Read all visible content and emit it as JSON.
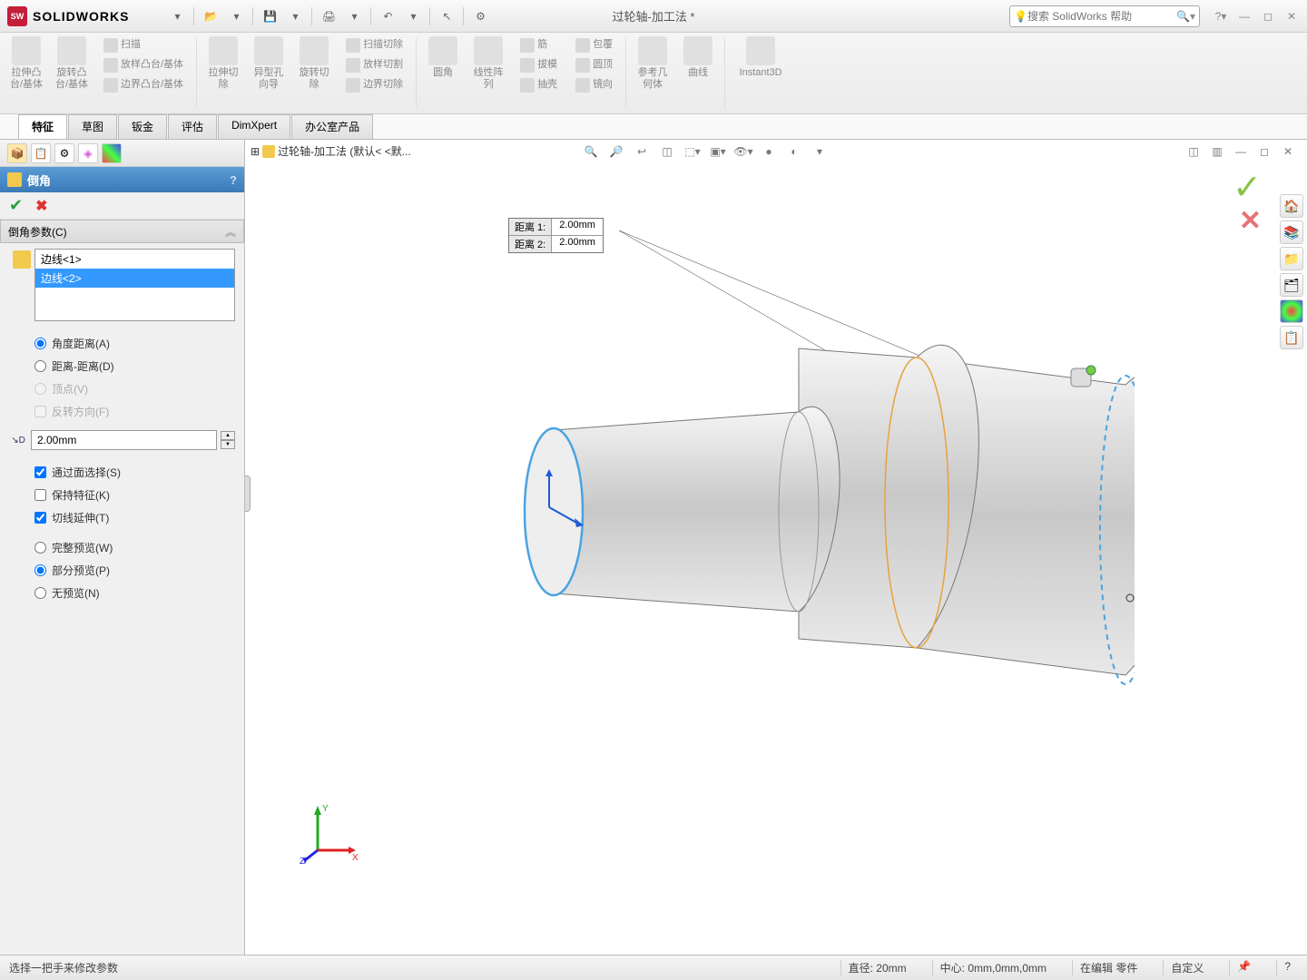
{
  "app": {
    "name_prefix": "SOLID",
    "name_suffix": "WORKS"
  },
  "document_title": "过轮轴-加工法 *",
  "search_placeholder": "搜索 SolidWorks 帮助",
  "ribbon": {
    "extrude_boss": "拉伸凸\n台/基体",
    "revolve_boss": "旋转凸\n台/基体",
    "sweep": "扫描",
    "loft_boss": "放样凸台/基体",
    "boundary_boss": "边界凸台/基体",
    "extrude_cut": "拉伸切\n除",
    "hole_wizard": "异型孔\n向导",
    "revolve_cut": "旋转切\n除",
    "sweep_cut": "扫描切除",
    "loft_cut": "放样切割",
    "boundary_cut": "边界切除",
    "fillet": "圆角",
    "linear_pattern": "线性阵\n列",
    "rib": "筋",
    "draft": "拔模",
    "shell": "抽壳",
    "wrap": "包覆",
    "dome": "圆顶",
    "mirror": "镜向",
    "ref_geom": "参考几\n何体",
    "curves": "曲线",
    "instant3d": "Instant3D"
  },
  "tabs": [
    "特征",
    "草图",
    "钣金",
    "评估",
    "DimXpert",
    "办公室产品"
  ],
  "breadcrumb": "过轮轴-加工法  (默认< <默...",
  "feature": {
    "title": "倒角",
    "section": "倒角参数(C)",
    "edges": [
      "边线<1>",
      "边线<2>"
    ],
    "radios1": [
      {
        "label": "角度距离(A)",
        "checked": true,
        "disabled": false
      },
      {
        "label": "距离-距离(D)",
        "checked": false,
        "disabled": false
      },
      {
        "label": "顶点(V)",
        "checked": false,
        "disabled": true
      }
    ],
    "flip": "反转方向(F)",
    "distance": "2.00mm",
    "checks": [
      {
        "label": "通过面选择(S)",
        "checked": true
      },
      {
        "label": "保持特征(K)",
        "checked": false
      },
      {
        "label": "切线延伸(T)",
        "checked": true
      }
    ],
    "radios2": [
      {
        "label": "完整预览(W)",
        "checked": false
      },
      {
        "label": "部分预览(P)",
        "checked": true
      },
      {
        "label": "无预览(N)",
        "checked": false
      }
    ]
  },
  "callout": {
    "r1_label": "距离 1:",
    "r1_val": "2.00mm",
    "r2_label": "距离 2:",
    "r2_val": "2.00mm"
  },
  "status": {
    "hint": "选择一把手来修改参数",
    "diameter": "直径: 20mm",
    "center": "中心: 0mm,0mm,0mm",
    "editing": "在编辑 零件",
    "custom": "自定义"
  }
}
